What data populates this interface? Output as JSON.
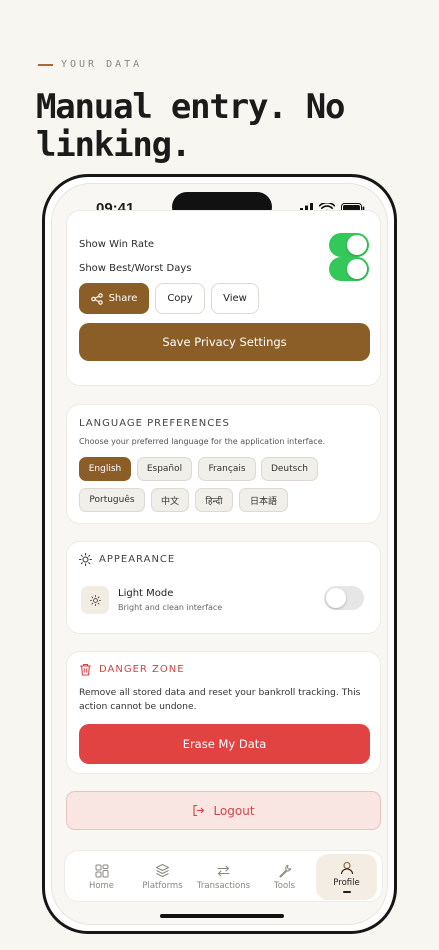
{
  "header": {
    "eyebrow": "YOUR DATA",
    "headline": "Manual entry. No linking."
  },
  "status_bar": {
    "time": "09:41"
  },
  "privacy": {
    "rows": [
      {
        "label": "Show Win Rate",
        "enabled": true
      },
      {
        "label": "Show Best/Worst Days",
        "enabled": true
      }
    ],
    "share_label": "Share",
    "copy_label": "Copy",
    "view_label": "View",
    "save_label": "Save Privacy Settings"
  },
  "language": {
    "title": "LANGUAGE PREFERENCES",
    "subtitle": "Choose your preferred language for the application interface.",
    "options": [
      "English",
      "Español",
      "Français",
      "Deutsch",
      "Português",
      "中文",
      "हिन्दी",
      "日本語"
    ],
    "selected": "English"
  },
  "appearance": {
    "title": "APPEARANCE",
    "mode_label": "Light Mode",
    "mode_desc": "Bright and clean interface",
    "dark_enabled": false
  },
  "danger": {
    "title": "DANGER ZONE",
    "text": "Remove all stored data and reset your bankroll tracking. This action cannot be undone.",
    "button": "Erase My Data"
  },
  "logout_label": "Logout",
  "tabs": [
    {
      "label": "Home",
      "icon": "grid-icon"
    },
    {
      "label": "Platforms",
      "icon": "layers-icon"
    },
    {
      "label": "Transactions",
      "icon": "arrows-icon"
    },
    {
      "label": "Tools",
      "icon": "wrench-icon"
    },
    {
      "label": "Profile",
      "icon": "user-icon",
      "active": true
    }
  ],
  "colors": {
    "brand": "#8b5e27",
    "toggle_on": "#34c759",
    "danger": "#e14343",
    "background": "#f8f6f1"
  }
}
